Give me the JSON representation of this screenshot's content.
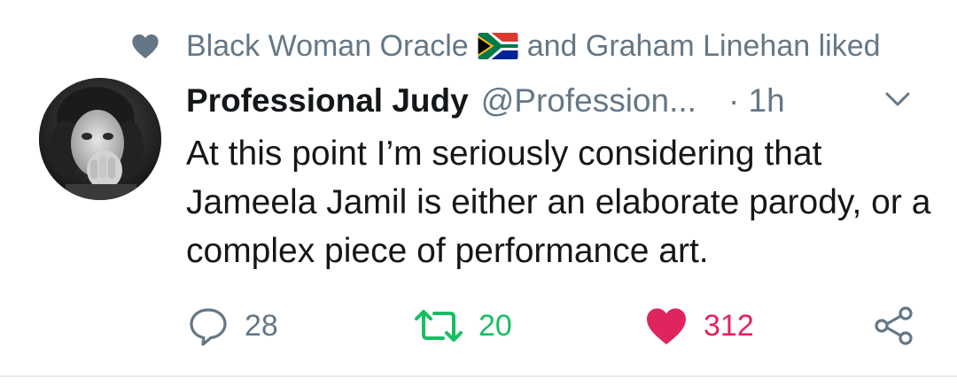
{
  "social_context": {
    "icon": "heart-icon",
    "text_before_flag": "Black Woman Oracle",
    "flag_icon": "south-africa-flag-icon",
    "text_after_flag": "and Graham Linehan liked"
  },
  "tweet": {
    "avatar_icon": "avatar",
    "display_name": "Professional Judy",
    "handle": "@Profession...",
    "time": "· 1h",
    "text": "At this point I’m seriously considering that Jameela Jamil is either an elaborate parody, or a complex piece of performance art."
  },
  "actions": {
    "reply_count": "28",
    "retweet_count": "20",
    "like_count": "312"
  },
  "colors": {
    "muted": "#657786",
    "retweet_green": "#17bf63",
    "like_red": "#e0245e",
    "text": "#14171a"
  }
}
